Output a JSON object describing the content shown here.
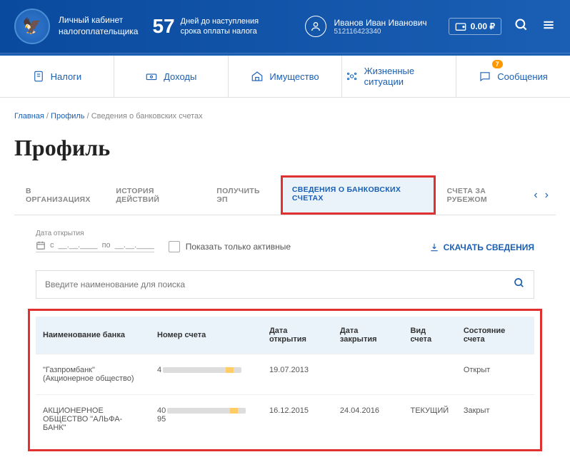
{
  "header": {
    "logo_line1": "Личный кабинет",
    "logo_line2": "налогоплательщика",
    "countdown_days": "57",
    "countdown_text1": "Дней до наступления",
    "countdown_text2": "срока оплаты налога",
    "user_name": "Иванов Иван Иванович",
    "user_id": "512116423340",
    "balance": "0.00 ₽"
  },
  "nav": {
    "items": [
      "Налоги",
      "Доходы",
      "Имущество",
      "Жизненные ситуации",
      "Сообщения"
    ],
    "msg_badge": "7"
  },
  "breadcrumb": {
    "home": "Главная",
    "parent": "Профиль",
    "current": "Сведения о банковских счетах"
  },
  "page_title": "Профиль",
  "tabs": [
    "В ОРГАНИЗАЦИЯХ",
    "ИСТОРИЯ ДЕЙСТВИЙ",
    "ПОЛУЧИТЬ ЭП",
    "СВЕДЕНИЯ О БАНКОВСКИХ СЧЕТАХ",
    "СЧЕТА ЗА РУБЕЖОМ"
  ],
  "filters": {
    "date_label": "Дата открытия",
    "date_from_prefix": "с",
    "date_from_placeholder": "__.__.____",
    "date_to_prefix": "по",
    "date_to_placeholder": "__.__.____",
    "active_only": "Показать только активные",
    "download": "СКАЧАТЬ СВЕДЕНИЯ"
  },
  "search": {
    "placeholder": "Введите наименование для поиска"
  },
  "table": {
    "headers": [
      "Наименование банка",
      "Номер счета",
      "Дата открытия",
      "Дата закрытия",
      "Вид счета",
      "Состояние счета"
    ],
    "rows": [
      {
        "bank": "\"Газпромбанк\" (Акционерное общество)",
        "acct_prefix": "4",
        "acct_suffix": "",
        "opened": "19.07.2013",
        "closed": "",
        "type": "",
        "state": "Открыт"
      },
      {
        "bank": "АКЦИОНЕРНОЕ ОБЩЕСТВО \"АЛЬФА-БАНК\"",
        "acct_prefix": "40",
        "acct_suffix": "95",
        "opened": "16.12.2015",
        "closed": "24.04.2016",
        "type": "ТЕКУЩИЙ",
        "state": "Закрыт"
      }
    ]
  }
}
